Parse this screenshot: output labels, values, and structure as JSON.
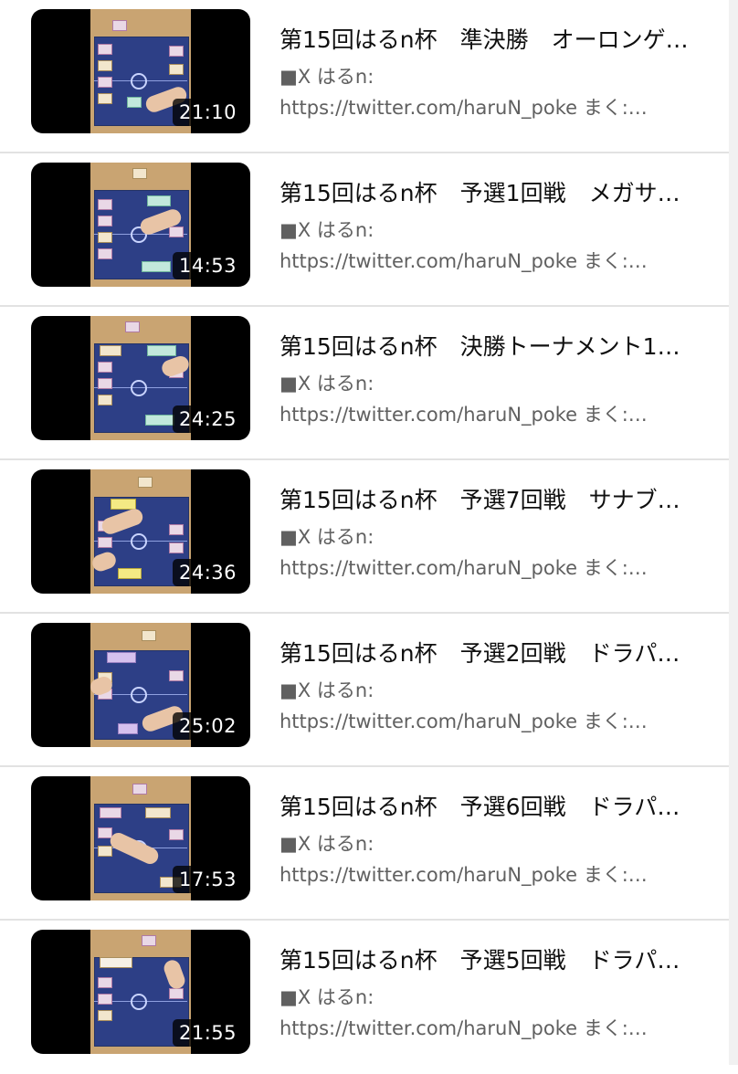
{
  "videos": [
    {
      "title": "第15回はるn杯　準決勝　オーロンゲ…",
      "desc1": "■X はるn:",
      "desc2": "https://twitter.com/haruN_poke まく:…",
      "duration": "21:10"
    },
    {
      "title": "第15回はるn杯　予選1回戦　メガサ…",
      "desc1": "■X はるn:",
      "desc2": "https://twitter.com/haruN_poke まく:…",
      "duration": "14:53"
    },
    {
      "title": "第15回はるn杯　決勝トーナメント1…",
      "desc1": "■X はるn:",
      "desc2": "https://twitter.com/haruN_poke まく:…",
      "duration": "24:25"
    },
    {
      "title": "第15回はるn杯　予選7回戦　サナブ…",
      "desc1": "■X はるn:",
      "desc2": "https://twitter.com/haruN_poke まく:…",
      "duration": "24:36"
    },
    {
      "title": "第15回はるn杯　予選2回戦　ドラパ…",
      "desc1": "■X はるn:",
      "desc2": "https://twitter.com/haruN_poke まく:…",
      "duration": "25:02"
    },
    {
      "title": "第15回はるn杯　予選6回戦　ドラパ…",
      "desc1": "■X はるn:",
      "desc2": "https://twitter.com/haruN_poke まく:…",
      "duration": "17:53"
    },
    {
      "title": "第15回はるn杯　予選5回戦　ドラパ…",
      "desc1": "■X はるn:",
      "desc2": "https://twitter.com/haruN_poke まく:…",
      "duration": "21:55"
    }
  ]
}
